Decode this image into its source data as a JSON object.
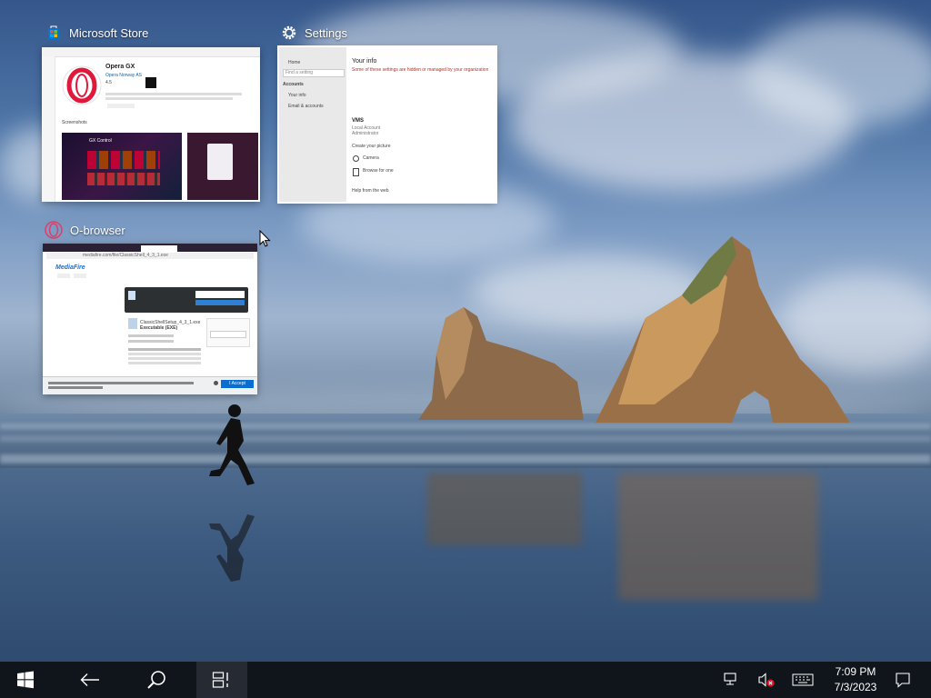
{
  "tasks": [
    {
      "title": "Microsoft Store",
      "icon": "store-icon",
      "app": {
        "name": "Opera GX",
        "publisher": "Opera Norway AS",
        "rating": "4.5",
        "section": "Screenshots",
        "promo": "GX Control"
      }
    },
    {
      "title": "Settings",
      "icon": "gear-icon",
      "app": {
        "nav_home": "Home",
        "nav_search": "Find a setting",
        "nav_section": "Accounts",
        "nav_item1": "Your info",
        "nav_item2": "Email & accounts",
        "heading": "Your info",
        "warning": "Some of these settings are hidden or managed by your organization.",
        "account_name": "VMS",
        "account_type": "Local Account",
        "account_role": "Administrator",
        "create_picture": "Create your picture",
        "camera": "Camera",
        "browse": "Browse for one",
        "help": "Help from the web"
      }
    },
    {
      "title": "O-browser",
      "icon": "opera-icon",
      "app": {
        "url": "mediafire.com/file/ClassicShell_4_3_1.exe",
        "brand": "MediaFire",
        "file_name": "ClassicShellSetup_4_3_1.exe",
        "file_type": "Executable (EXE)",
        "download_label": "Download",
        "accept_label": "I Accept"
      }
    }
  ],
  "taskbar": {
    "clock_time": "7:09 PM",
    "clock_date": "7/3/2023"
  },
  "colors": {
    "taskbar": "#10151c",
    "opera_red": "#d61a32",
    "accent_blue": "#0a6ed1"
  }
}
